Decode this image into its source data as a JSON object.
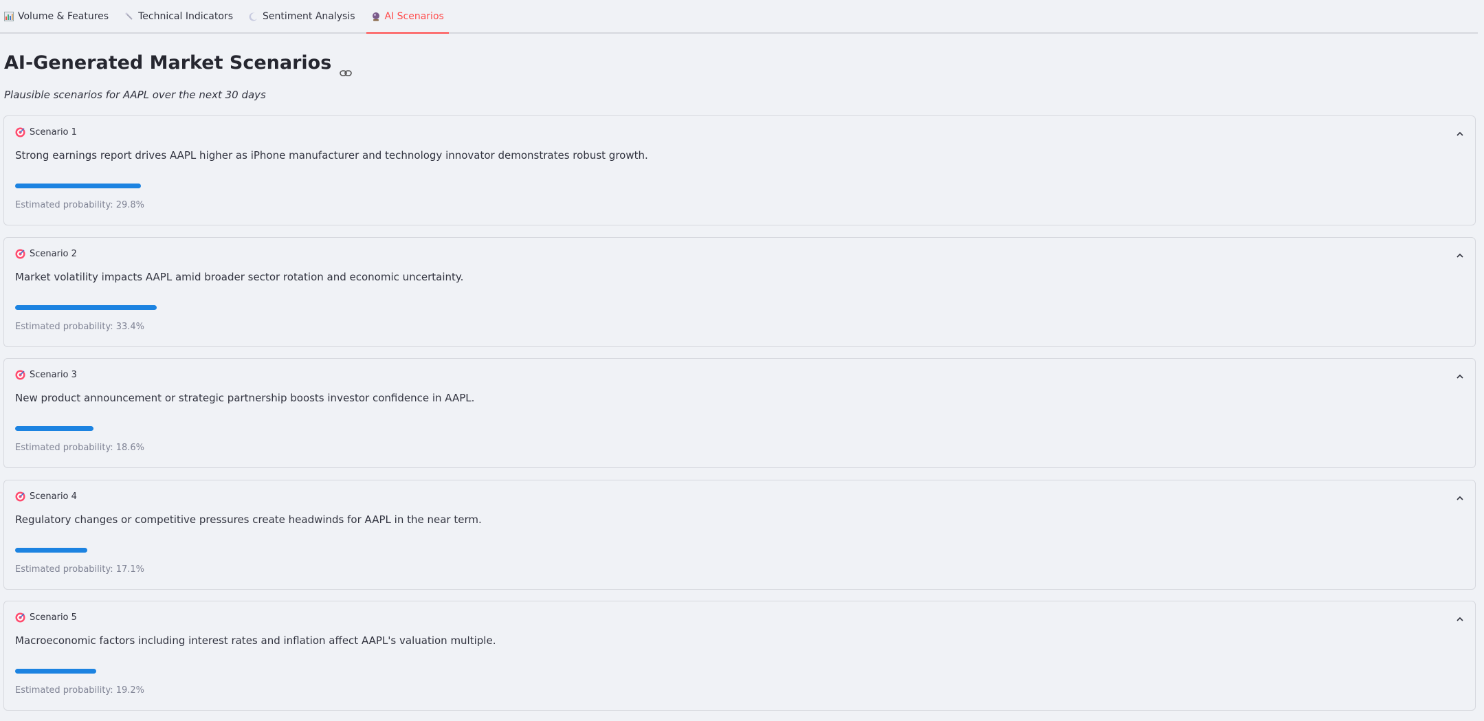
{
  "tabs": [
    {
      "label": "Volume & Features",
      "icon": "bar-chart-icon"
    },
    {
      "label": "Technical Indicators",
      "icon": "sparkle-icon"
    },
    {
      "label": "Sentiment Analysis",
      "icon": "moon-icon"
    },
    {
      "label": "AI Scenarios",
      "icon": "crystal-ball-icon",
      "active": true
    }
  ],
  "page": {
    "title": "AI-Generated Market Scenarios",
    "subtitle": "Plausible scenarios for AAPL over the next 30 days"
  },
  "colors": {
    "accent": "#ff4b4b",
    "progress": "#1c83e1",
    "background": "#f0f2f6"
  },
  "scenarios": [
    {
      "title": "Scenario 1",
      "text": "Strong earnings report drives AAPL higher as iPhone manufacturer and technology innovator demonstrates robust growth.",
      "probability": 0.298,
      "probability_label": "Estimated probability: 29.8%"
    },
    {
      "title": "Scenario 2",
      "text": "Market volatility impacts AAPL amid broader sector rotation and economic uncertainty.",
      "probability": 0.334,
      "probability_label": "Estimated probability: 33.4%"
    },
    {
      "title": "Scenario 3",
      "text": "New product announcement or strategic partnership boosts investor confidence in AAPL.",
      "probability": 0.186,
      "probability_label": "Estimated probability: 18.6%"
    },
    {
      "title": "Scenario 4",
      "text": "Regulatory changes or competitive pressures create headwinds for AAPL in the near term.",
      "probability": 0.171,
      "probability_label": "Estimated probability: 17.1%"
    },
    {
      "title": "Scenario 5",
      "text": "Macroeconomic factors including interest rates and inflation affect AAPL's valuation multiple.",
      "probability": 0.192,
      "probability_label": "Estimated probability: 19.2%"
    }
  ]
}
